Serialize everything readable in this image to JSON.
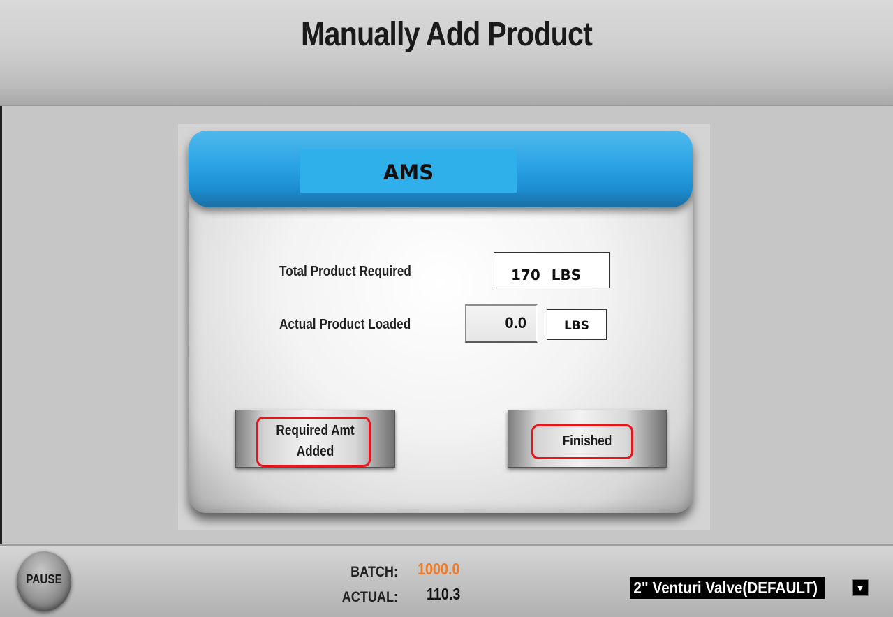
{
  "header": {
    "title": "Manually Add Product"
  },
  "dialog": {
    "title": "AMS",
    "total_required_label": "Total Product Required",
    "total_required_value": "170",
    "total_required_unit": "LBS",
    "actual_loaded_label": "Actual Product Loaded",
    "actual_loaded_value": "0.0",
    "actual_loaded_unit": "LBS",
    "required_added_line1": "Required Amt",
    "required_added_line2": "Added",
    "finished_label": "Finished"
  },
  "footer": {
    "pause_label": "PAUSE",
    "batch_label": "BATCH:",
    "batch_value": "1000.0",
    "actual_label": "ACTUAL:",
    "actual_value": "110.3",
    "valve_selected": "2\" Venturi Valve(DEFAULT)"
  },
  "colors": {
    "batch_value": "#f07a28",
    "title_bar": "#2ba4e4",
    "highlight_outline": "#e8141b"
  },
  "icons": {
    "dropdown": "chevron-down-icon"
  }
}
